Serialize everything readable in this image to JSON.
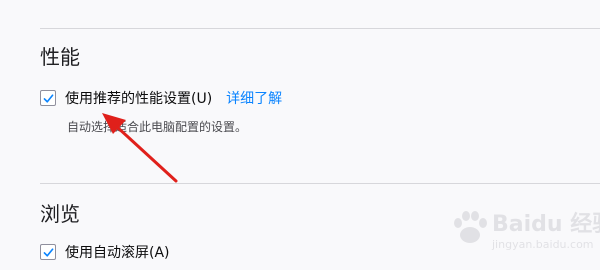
{
  "performance": {
    "title": "性能",
    "use_recommended_label": "使用推荐的性能设置(U)",
    "use_recommended_checked": true,
    "learn_more": "详细了解",
    "description": "自动选择适合此电脑配置的设置。"
  },
  "browsing": {
    "title": "浏览",
    "autoscroll_label": "使用自动滚屏(A)",
    "autoscroll_checked": true
  },
  "watermark": {
    "brand": "Baidu 经验",
    "url": "jingyan.baidu.com"
  },
  "colors": {
    "accent": "#0a84ff",
    "arrow": "#e0201b",
    "background": "#f9f9fb"
  }
}
